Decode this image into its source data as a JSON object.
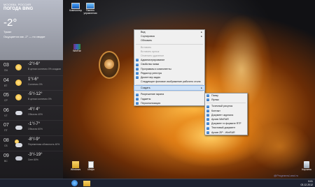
{
  "weather": {
    "city": "МОСКВА, РОССИЯ",
    "title": "ПОГОДА BING",
    "current_temp": "-2°",
    "condition": "Туман",
    "condition_detail": "Ощущается как -2° — по сводке",
    "days": [
      {
        "num": "03",
        "weekday": "ПН",
        "temp": "-2°/-6°",
        "desc": "В целом солнечно 0% осадков",
        "icon": "sun-icon"
      },
      {
        "num": "04",
        "weekday": "ВТ",
        "temp": "1°/-6°",
        "desc": "Солнечно 0%",
        "icon": "sun-icon"
      },
      {
        "num": "05",
        "weekday": "СР",
        "temp": "-5°/-12°",
        "desc": "В целом солнечно 0%",
        "icon": "sun-icon"
      },
      {
        "num": "06",
        "weekday": "ЧТ",
        "temp": "-4°/ 4°",
        "desc": "Облачно 40%",
        "icon": "cloud-icon"
      },
      {
        "num": "07",
        "weekday": "ПТ",
        "temp": "-1°/-7°",
        "desc": "Облачно 60%",
        "icon": "cloud-icon"
      },
      {
        "num": "08",
        "weekday": "СБ",
        "temp": "-8°/-9°",
        "desc": "Переменная облачность 40%",
        "icon": "partly-cloudy-icon"
      },
      {
        "num": "09",
        "weekday": "ВС",
        "temp": "-3°/-19°",
        "desc": "Снег 80%",
        "icon": "snow-icon"
      }
    ]
  },
  "desktop_icons": [
    {
      "label": "Компьютер",
      "icon": "computer-icon"
    },
    {
      "label": "Панель управления",
      "icon": "control-panel-icon"
    },
    {
      "label": "WinRar",
      "icon": "winrar-icon"
    },
    {
      "label": "Корзина",
      "icon": "recycle-bin-icon"
    },
    {
      "label": "Windows",
      "icon": "folder-icon"
    },
    {
      "label": "Инфо",
      "icon": "document-icon"
    }
  ],
  "context_menu": {
    "items": [
      {
        "label": "Вид",
        "arrow": true
      },
      {
        "label": "Сортировка",
        "arrow": true
      },
      {
        "label": "Обновить"
      },
      {
        "sep": true
      },
      {
        "label": "Вставить",
        "disabled": true
      },
      {
        "label": "Вставить ярлык",
        "disabled": true
      },
      {
        "label": "Отменить удаление",
        "disabled": true
      },
      {
        "label": "Администрирование",
        "icon": true
      },
      {
        "label": "Свойства папки",
        "icon": true
      },
      {
        "label": "Программы и компоненты",
        "icon": true
      },
      {
        "label": "Редактор реестра",
        "icon": true
      },
      {
        "label": "Диспетчер задач",
        "icon": true
      },
      {
        "label": "Следующее фоновое изображение рабочего стола"
      },
      {
        "sep": true
      },
      {
        "label": "Создать",
        "arrow": true,
        "highlight": true
      },
      {
        "sep": true
      },
      {
        "label": "Разрешение экрана",
        "icon": true
      },
      {
        "label": "Гаджеты",
        "icon": true
      },
      {
        "label": "Персонализация",
        "icon": true
      }
    ]
  },
  "submenu": {
    "items": [
      {
        "label": "Папку",
        "icon": true
      },
      {
        "label": "Ярлык",
        "icon": true
      },
      {
        "sep": true
      },
      {
        "label": "Точечный рисунок",
        "icon": true
      },
      {
        "label": "Контакт",
        "icon": true
      },
      {
        "label": "Документ журнала",
        "icon": true
      },
      {
        "label": "Архив WinRAR",
        "icon": true
      },
      {
        "label": "Документ в формате RTF",
        "icon": true
      },
      {
        "label": "Текстовый документ",
        "icon": true
      },
      {
        "label": "Архив ZIP - WinRAR",
        "icon": true
      }
    ]
  },
  "taskbar": {
    "time": "9:01",
    "date": "03.12.2012",
    "watermark": "@ProgramsLand.ru"
  }
}
